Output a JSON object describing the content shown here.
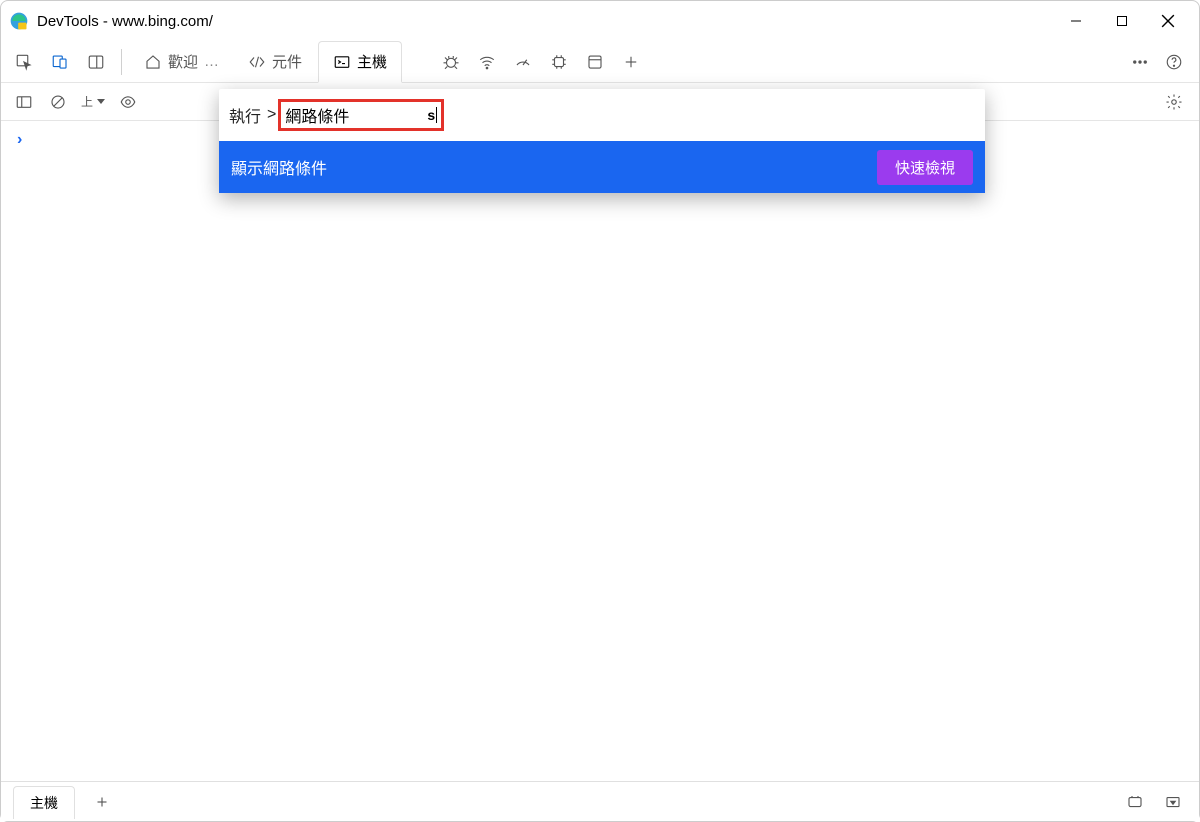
{
  "window": {
    "title": "DevTools - www.bing.com/"
  },
  "tabs": {
    "welcome": "歡迎",
    "elements": "元件",
    "console": "主機"
  },
  "command_menu": {
    "run_label": "執行",
    "prompt": ">",
    "input_value": "網路條件",
    "trailing": "s",
    "result_label": "顯示網路條件",
    "badge": "快速檢視"
  },
  "sub_toolbar": {
    "context_label": "上"
  },
  "drawer": {
    "tab_label": "主機"
  },
  "icons": {
    "inspect": "inspect",
    "device": "device",
    "dock": "dock",
    "home": "home",
    "code": "code",
    "terminal": "terminal",
    "bug": "bug",
    "wifi": "wifi",
    "perf": "perf",
    "chip": "chip",
    "app": "app",
    "plus": "plus",
    "more": "more",
    "help": "help",
    "sidebar": "sidebar",
    "clear": "clear",
    "eye": "eye",
    "gear": "gear"
  }
}
